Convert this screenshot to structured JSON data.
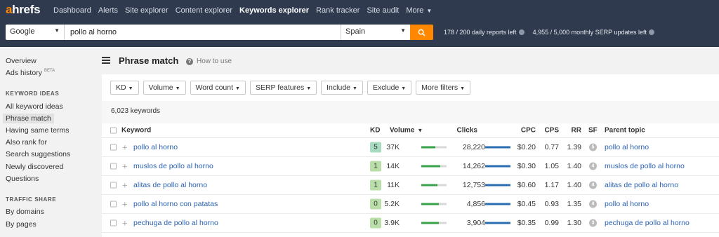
{
  "logo": {
    "first": "a",
    "rest": "hrefs"
  },
  "nav": [
    {
      "label": "Dashboard",
      "name": "nav-dashboard"
    },
    {
      "label": "Alerts",
      "name": "nav-alerts"
    },
    {
      "label": "Site explorer",
      "name": "nav-site-explorer"
    },
    {
      "label": "Content explorer",
      "name": "nav-content-explorer"
    },
    {
      "label": "Keywords explorer",
      "name": "nav-keywords-explorer",
      "active": true
    },
    {
      "label": "Rank tracker",
      "name": "nav-rank-tracker"
    },
    {
      "label": "Site audit",
      "name": "nav-site-audit"
    },
    {
      "label": "More",
      "name": "nav-more",
      "caret": true
    }
  ],
  "search": {
    "engine": "Google",
    "query": "pollo al horno",
    "country": "Spain"
  },
  "limits": {
    "daily": "178 / 200 daily reports left",
    "monthly": "4,955 / 5,000 monthly SERP updates left"
  },
  "sidebar": {
    "top": [
      "Overview",
      "Ads history"
    ],
    "beta": "BETA",
    "ideas_head": "KEYWORD IDEAS",
    "ideas": [
      "All keyword ideas",
      "Phrase match",
      "Having same terms",
      "Also rank for",
      "Search suggestions",
      "Newly discovered",
      "Questions"
    ],
    "traffic_head": "TRAFFIC SHARE",
    "traffic": [
      "By domains",
      "By pages"
    ]
  },
  "header": {
    "title": "Phrase match",
    "howto": "How to use"
  },
  "filters": [
    "KD",
    "Volume",
    "Word count",
    "SERP features",
    "Include",
    "Exclude",
    "More filters"
  ],
  "count_text": "6,023 keywords",
  "columns": {
    "keyword": "Keyword",
    "kd": "KD",
    "volume": "Volume",
    "clicks": "Clicks",
    "cpc": "CPC",
    "cps": "CPS",
    "rr": "RR",
    "sf": "SF",
    "parent": "Parent topic"
  },
  "colors": {
    "accent": "#ff8800",
    "topbar": "#2f3a4e",
    "link": "#2a61b1",
    "kd_easy": "#a8dcc0",
    "kd_mid": "#b9dea8"
  },
  "rows": [
    {
      "keyword": "pollo al horno",
      "kd": "5",
      "volume": "37K",
      "vol_frac": 0.55,
      "clicks": "28,220",
      "clicks_frac": 1.0,
      "cpc": "$0.20",
      "cps": "0.77",
      "rr": "1.39",
      "sf": "5",
      "parent": "pollo al horno"
    },
    {
      "keyword": "muslos de pollo al horno",
      "kd": "1",
      "volume": "14K",
      "vol_frac": 0.75,
      "clicks": "14,262",
      "clicks_frac": 1.0,
      "cpc": "$0.30",
      "cps": "1.05",
      "rr": "1.40",
      "sf": "4",
      "parent": "muslos de pollo al horno"
    },
    {
      "keyword": "alitas de pollo al horno",
      "kd": "1",
      "volume": "11K",
      "vol_frac": 0.65,
      "clicks": "12,753",
      "clicks_frac": 1.0,
      "cpc": "$0.60",
      "cps": "1.17",
      "rr": "1.40",
      "sf": "4",
      "parent": "alitas de pollo al horno"
    },
    {
      "keyword": "pollo al horno con patatas",
      "kd": "0",
      "volume": "5.2K",
      "vol_frac": 0.7,
      "clicks": "4,856",
      "clicks_frac": 1.0,
      "cpc": "$0.45",
      "cps": "0.93",
      "rr": "1.35",
      "sf": "4",
      "parent": "pollo al horno"
    },
    {
      "keyword": "pechuga de pollo al horno",
      "kd": "0",
      "volume": "3.9K",
      "vol_frac": 0.7,
      "clicks": "3,904",
      "clicks_frac": 1.0,
      "cpc": "$0.35",
      "cps": "0.99",
      "rr": "1.30",
      "sf": "3",
      "parent": "pechuga de pollo al horno"
    }
  ]
}
